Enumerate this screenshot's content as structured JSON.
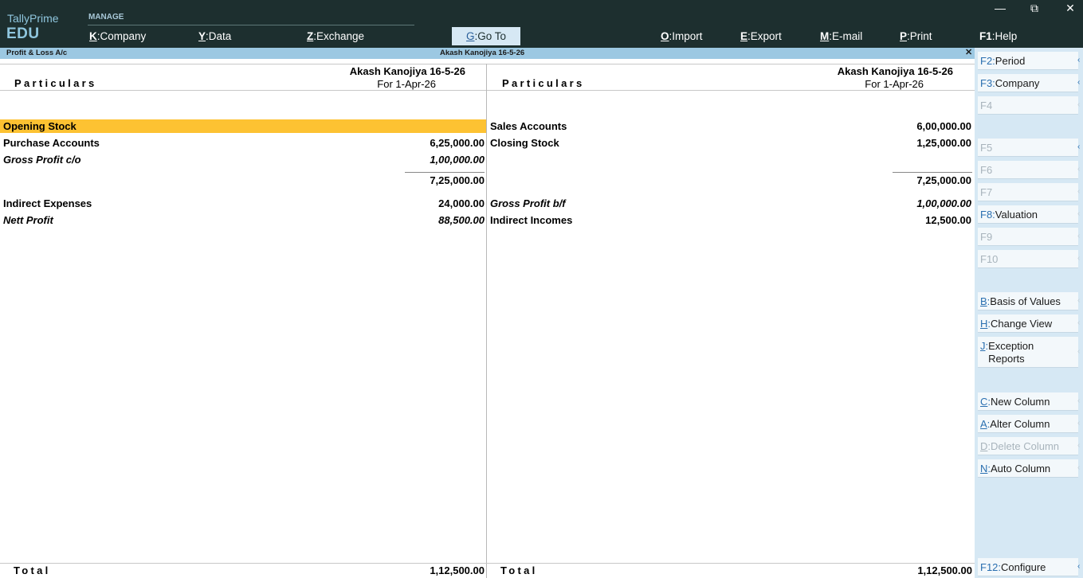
{
  "app": {
    "brand_top": "TallyPrime",
    "brand_bottom": "EDU",
    "manage_label": "MANAGE"
  },
  "menu": {
    "company": {
      "key": "K",
      "label": "Company"
    },
    "data": {
      "key": "Y",
      "label": "Data"
    },
    "exchange": {
      "key": "Z",
      "label": "Exchange"
    },
    "goto": {
      "key": "G",
      "label": "Go To"
    },
    "import": {
      "key": "O",
      "label": "Import"
    },
    "export": {
      "key": "E",
      "label": "Export"
    },
    "email": {
      "key": "M",
      "label": "E-mail"
    },
    "print": {
      "key": "P",
      "label": "Print"
    },
    "help": {
      "key": "F1",
      "label": "Help"
    }
  },
  "window_controls": {
    "minimize": "—",
    "restore": "⧉",
    "close": "✕"
  },
  "title_strip": {
    "left": "Profit & Loss A/c",
    "center": "Akash Kanojiya 16-5-26",
    "close": "✕"
  },
  "report": {
    "left": {
      "particulars": "Particulars",
      "company": "Akash Kanojiya 16-5-26",
      "period": "For 1-Apr-26",
      "rows": [
        {
          "label": "Opening Stock",
          "amount": ""
        },
        {
          "label": "Purchase Accounts",
          "amount": "6,25,000.00"
        },
        {
          "label": "Gross Profit c/o",
          "amount": "1,00,000.00"
        },
        {
          "label": "",
          "amount": "7,25,000.00"
        },
        {
          "label": "Indirect Expenses",
          "amount": "24,000.00"
        },
        {
          "label": "Nett Profit",
          "amount": "88,500.00"
        }
      ],
      "total_label": "Total",
      "total_amount": "1,12,500.00"
    },
    "right": {
      "particulars": "Particulars",
      "company": "Akash Kanojiya 16-5-26",
      "period": "For 1-Apr-26",
      "rows": [
        {
          "label": "Sales Accounts",
          "amount": "6,00,000.00"
        },
        {
          "label": "Closing Stock",
          "amount": "1,25,000.00"
        },
        {
          "label": "",
          "amount": "7,25,000.00"
        },
        {
          "label": "Gross Profit b/f",
          "amount": "1,00,000.00"
        },
        {
          "label": "Indirect Incomes",
          "amount": "12,500.00"
        }
      ],
      "total_label": "Total",
      "total_amount": "1,12,500.00"
    }
  },
  "side_buttons": {
    "f2": {
      "key": "F2:",
      "label": "Period"
    },
    "f3": {
      "key": "F3:",
      "label": "Company"
    },
    "f4": {
      "key": "F4",
      "label": ""
    },
    "f5": {
      "key": "F5",
      "label": ""
    },
    "f6": {
      "key": "F6",
      "label": ""
    },
    "f7": {
      "key": "F7",
      "label": ""
    },
    "f8": {
      "key": "F8:",
      "label": "Valuation"
    },
    "f9": {
      "key": "F9",
      "label": ""
    },
    "f10": {
      "key": "F10",
      "label": ""
    },
    "b": {
      "key": "B",
      "label": "Basis of Values"
    },
    "h": {
      "key": "H",
      "label": "Change View"
    },
    "j": {
      "key": "J",
      "label1": "Exception",
      "label2": "Reports"
    },
    "c": {
      "key": "C",
      "label": "New Column"
    },
    "a": {
      "key": "A",
      "label": "Alter Column"
    },
    "d": {
      "key": "D",
      "label": "Delete Column"
    },
    "n": {
      "key": "N",
      "label": "Auto Column"
    },
    "f12": {
      "key": "F12:",
      "label": "Configure"
    }
  },
  "colors": {
    "topbar": "#1d2f2f",
    "brand": "#8fc6de",
    "title_strip": "#9cc8e2",
    "highlight": "#fdc232",
    "side_panel": "#d6e8f4"
  }
}
